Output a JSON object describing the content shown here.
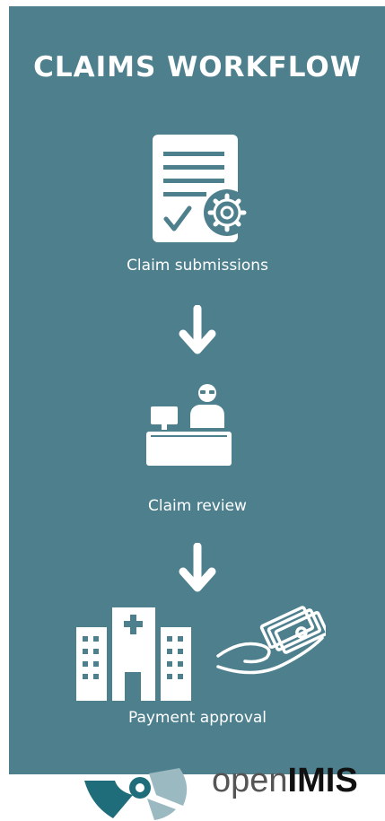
{
  "title": "CLAIMS WORKFLOW",
  "steps": [
    {
      "label": "Claim submissions",
      "icon": "document-gear-icon"
    },
    {
      "label": "Claim review",
      "icon": "reviewer-desk-icon"
    },
    {
      "label": "Payment approval",
      "icon": "hospital-payment-icon"
    }
  ],
  "logo": {
    "light": "open",
    "bold": "IMIS"
  },
  "colors": {
    "panel": "#4d7f8d",
    "foreground": "#ffffff",
    "logo_dark": "#1f6d7a",
    "logo_light": "#9ab9c0"
  }
}
